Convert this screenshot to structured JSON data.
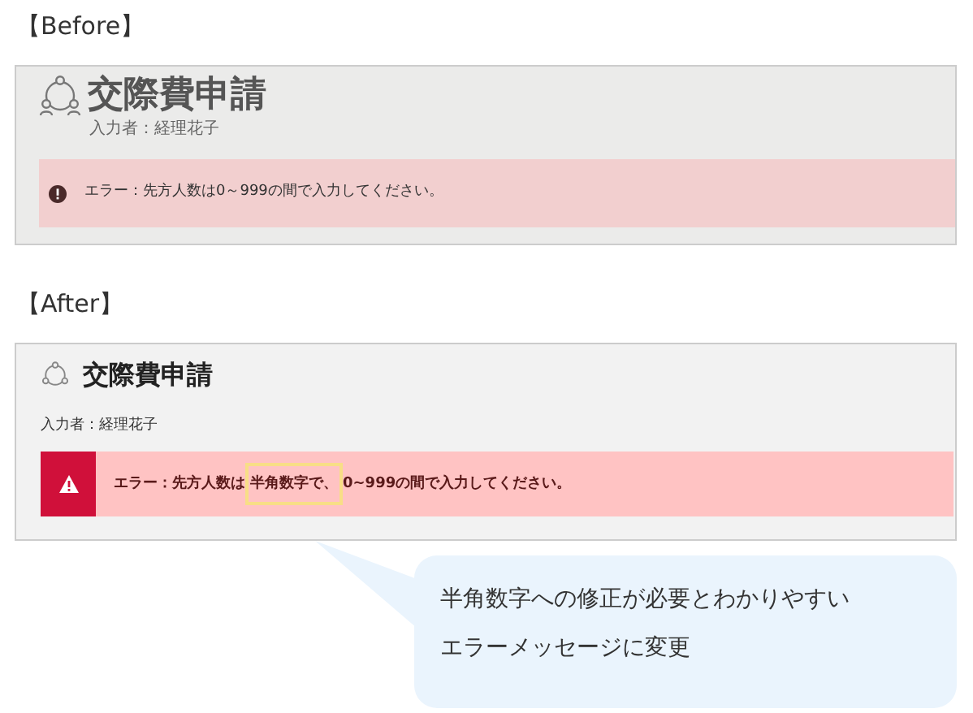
{
  "sections": [
    {
      "label": "【Before】",
      "kind": "before",
      "screen": {
        "title": "交際費申請",
        "author": "入力者：経理花子",
        "error": {
          "parts": [
            {
              "text": "エラー：先方人数は0～999の間で入力してください。",
              "highlighted": false
            }
          ]
        }
      }
    },
    {
      "label": "【After】",
      "kind": "after",
      "screen": {
        "title": "交際費申請",
        "author": "入力者：経理花子",
        "error": {
          "parts": [
            {
              "text": "エラー：先方人数は",
              "highlighted": false
            },
            {
              "text": "半角数字で、",
              "highlighted": true
            },
            {
              "text": "0~999の間で入力してください。",
              "highlighted": false
            }
          ]
        }
      }
    }
  ],
  "callout": {
    "lines": [
      "半角数字への修正が必要とわかりやすい",
      "エラーメッセージに変更"
    ]
  }
}
